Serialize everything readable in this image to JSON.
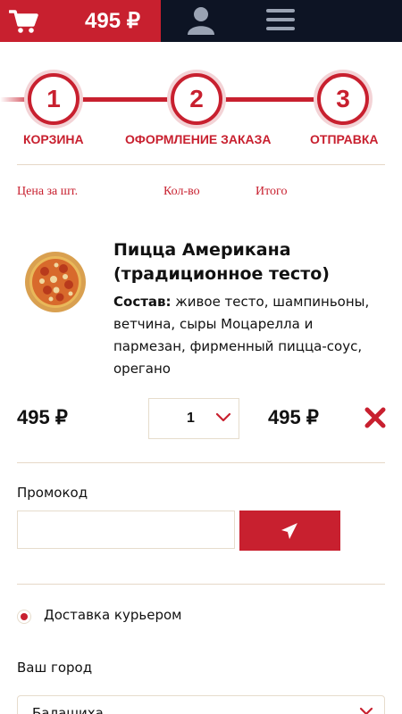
{
  "header": {
    "cart_total": "495 ₽",
    "icons": [
      "cart-icon",
      "user-icon",
      "menu-icon"
    ]
  },
  "steps": [
    {
      "number": "1",
      "label": "КОРЗИНА"
    },
    {
      "number": "2",
      "label": "ОФОРМЛЕНИЕ ЗАКАЗА"
    },
    {
      "number": "3",
      "label": "ОТПРАВКА"
    }
  ],
  "columns": {
    "unit_price": "Цена за шт.",
    "quantity": "Кол-во",
    "total": "Итого"
  },
  "cart_items": [
    {
      "title": "Пицца Американа (традиционное тесто)",
      "composition_label": "Состав:",
      "composition": " живое тесто, шампиньоны, ветчина, сыры Моцарелла и пармезан, фирменный пицца-соус, орегано",
      "unit_price": "495 ₽",
      "quantity": "1",
      "total": "495 ₽"
    }
  ],
  "promo": {
    "label": "Промокод",
    "value": "",
    "placeholder": ""
  },
  "delivery": {
    "selected_option": "Доставка курьером"
  },
  "city": {
    "label": "Ваш город",
    "selected": "Балашиха"
  },
  "colors": {
    "accent": "#c8202f",
    "header_bg": "#0d1424",
    "border": "#e6dccc"
  }
}
